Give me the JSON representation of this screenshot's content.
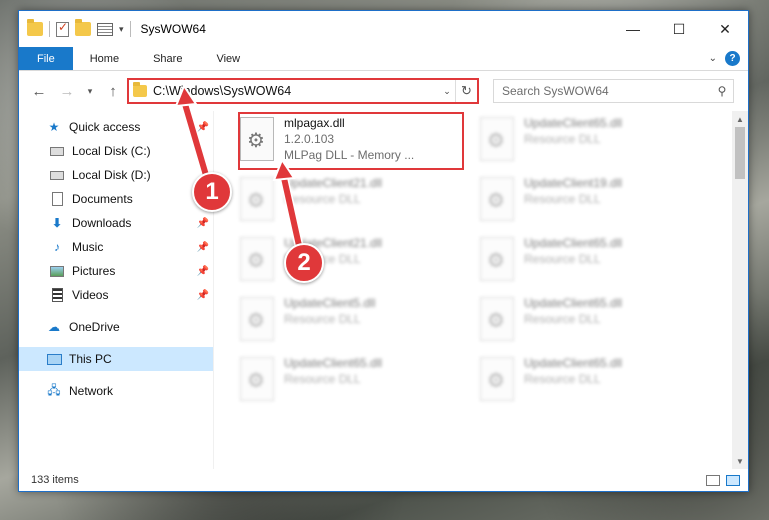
{
  "window": {
    "title": "SysWOW64",
    "controls": {
      "minimize": "—",
      "maximize": "☐",
      "close": "✕"
    }
  },
  "ribbon": {
    "tabs": [
      "File",
      "Home",
      "Share",
      "View"
    ],
    "help": "?"
  },
  "nav": {
    "address": "C:\\Windows\\SysWOW64",
    "search_placeholder": "Search SysWOW64"
  },
  "sidebar": {
    "items": [
      {
        "label": "Quick access",
        "icon": "star-icon"
      },
      {
        "label": "Local Disk (C:)",
        "icon": "drive-icon"
      },
      {
        "label": "Local Disk (D:)",
        "icon": "drive-icon"
      },
      {
        "label": "Documents",
        "icon": "document-icon"
      },
      {
        "label": "Downloads",
        "icon": "download-icon"
      },
      {
        "label": "Music",
        "icon": "music-icon"
      },
      {
        "label": "Pictures",
        "icon": "pictures-icon"
      },
      {
        "label": "Videos",
        "icon": "videos-icon"
      },
      {
        "label": "OneDrive",
        "icon": "cloud-icon"
      },
      {
        "label": "This PC",
        "icon": "computer-icon"
      },
      {
        "label": "Network",
        "icon": "network-icon"
      }
    ]
  },
  "files": [
    {
      "name": "mlpagax.dll",
      "line2": "1.2.0.103",
      "line3": "MLPag DLL - Memory ..."
    },
    {
      "name": "UpdateClient65.dll",
      "line2": "Resource DLL"
    },
    {
      "name": "UpdateClient21.dll",
      "line2": "Resource DLL"
    },
    {
      "name": "UpdateClient19.dll",
      "line2": "Resource DLL"
    },
    {
      "name": "UpdateClient21.dll",
      "line2": "Resource DLL"
    },
    {
      "name": "UpdateClient65.dll",
      "line2": "Resource DLL"
    },
    {
      "name": "UpdateClient5.dll",
      "line2": "Resource DLL"
    },
    {
      "name": "UpdateClient65.dll",
      "line2": "Resource DLL"
    },
    {
      "name": "UpdateClient65.dll",
      "line2": "Resource DLL"
    },
    {
      "name": "UpdateClient65.dll",
      "line2": "Resource DLL"
    }
  ],
  "status": {
    "item_count": "133 items"
  },
  "callouts": [
    "1",
    "2"
  ],
  "colors": {
    "accent": "#1979ca",
    "annotation": "#e0383a",
    "selected": "#cce8ff"
  }
}
